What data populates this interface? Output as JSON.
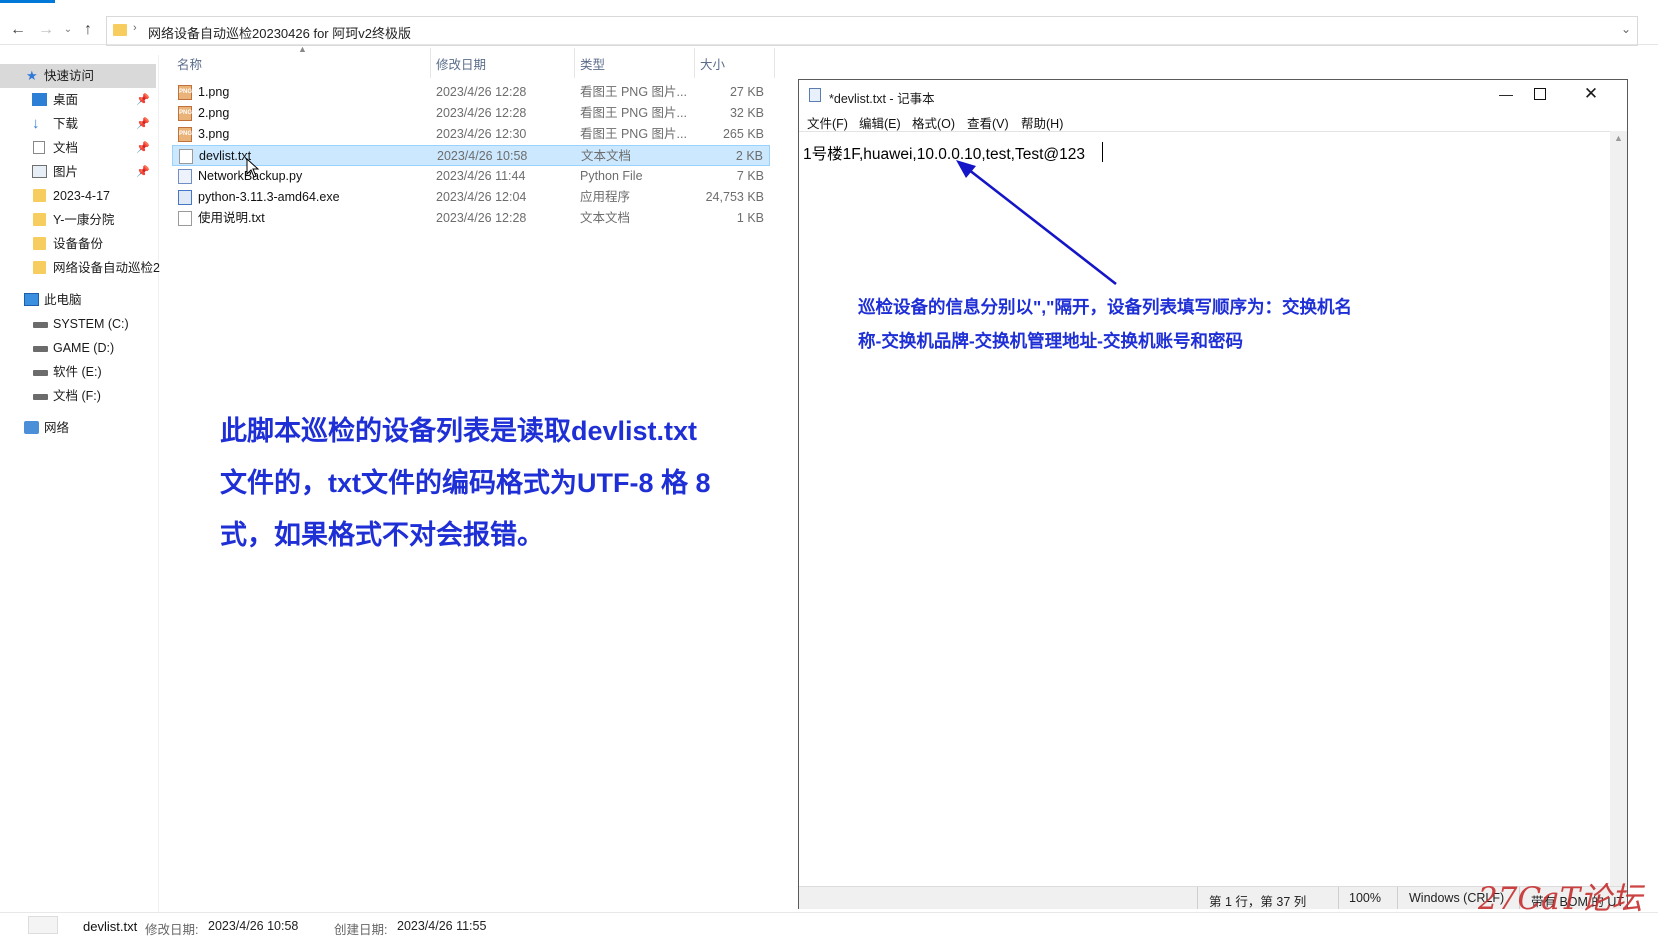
{
  "explorer": {
    "address_path": "网络设备自动巡检20230426 for 阿珂v2终极版",
    "columns": {
      "name": "名称",
      "date": "修改日期",
      "type": "类型",
      "size": "大小"
    },
    "nav": {
      "quick_access": "快速访问",
      "items": [
        {
          "label": "桌面",
          "pinned": true
        },
        {
          "label": "下载",
          "pinned": true
        },
        {
          "label": "文档",
          "pinned": true
        },
        {
          "label": "图片",
          "pinned": true
        },
        {
          "label": "2023-4-17"
        },
        {
          "label": "Y-一康分院"
        },
        {
          "label": "设备备份"
        },
        {
          "label": "网络设备自动巡检2"
        }
      ],
      "this_pc": "此电脑",
      "drives": [
        "SYSTEM (C:)",
        "GAME (D:)",
        "软件 (E:)",
        "文档 (F:)"
      ],
      "network": "网络"
    },
    "files": [
      {
        "name": "1.png",
        "date": "2023/4/26 12:28",
        "type": "看图王 PNG 图片...",
        "size": "27 KB",
        "icon": "png-image-icon"
      },
      {
        "name": "2.png",
        "date": "2023/4/26 12:28",
        "type": "看图王 PNG 图片...",
        "size": "32 KB",
        "icon": "png-image-icon"
      },
      {
        "name": "3.png",
        "date": "2023/4/26 12:30",
        "type": "看图王 PNG 图片...",
        "size": "265 KB",
        "icon": "png-image-icon"
      },
      {
        "name": "devlist.txt",
        "date": "2023/4/26 10:58",
        "type": "文本文档",
        "size": "2 KB",
        "icon": "text-file-icon",
        "selected": true
      },
      {
        "name": "NetworkBackup.py",
        "date": "2023/4/26 11:44",
        "type": "Python File",
        "size": "7 KB",
        "icon": "python-file-icon"
      },
      {
        "name": "python-3.11.3-amd64.exe",
        "date": "2023/4/26 12:04",
        "type": "应用程序",
        "size": "24,753 KB",
        "icon": "installer-icon"
      },
      {
        "name": "使用说明.txt",
        "date": "2023/4/26 12:28",
        "type": "文本文档",
        "size": "1 KB",
        "icon": "text-file-icon"
      }
    ],
    "details": {
      "name": "devlist.txt",
      "modified_label": "修改日期:",
      "modified": "2023/4/26 10:58",
      "created_label": "创建日期:",
      "created": "2023/4/26 11:55"
    }
  },
  "annotation_left": {
    "line1": "此脚本巡检的设备列表是读取devlist.txt",
    "line2": "文件的，txt文件的编码格式为UTF-8 格 8",
    "line3": "式，如果格式不对会报错。"
  },
  "annotation_right": {
    "line1": "巡检设备的信息分别以\",\"隔开，设备列表填写顺序为：交换机名",
    "line2": "称-交换机品牌-交换机管理地址-交换机账号和密码"
  },
  "notepad": {
    "title": "*devlist.txt - 记事本",
    "menu": [
      "文件(F)",
      "编辑(E)",
      "格式(O)",
      "查看(V)",
      "帮助(H)"
    ],
    "content": "1号楼1F,huawei,10.0.0.10,test,Test@123",
    "status": {
      "position": "第 1 行，第 37 列",
      "zoom": "100%",
      "line_ending": "Windows (CRLF)",
      "encoding": "带有 BOM 的 UT"
    }
  },
  "watermark": "27CaT论坛",
  "colors": {
    "annotation": "#1f2fd6",
    "selection": "#cce8ff",
    "arrow": "#1515c8"
  }
}
